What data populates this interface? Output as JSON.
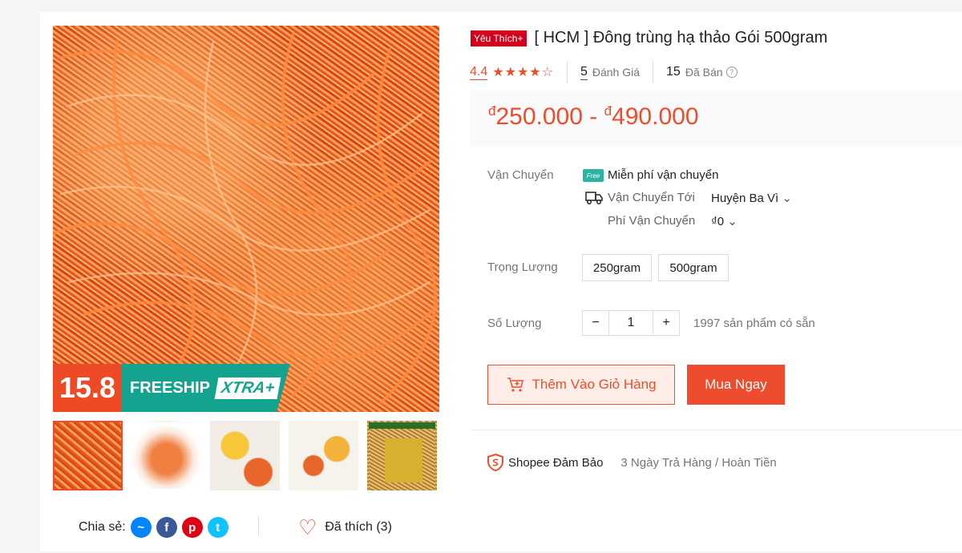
{
  "gallery": {
    "promo_number": "15.8",
    "promo_freeship": "FREESHIP",
    "promo_xtra": "XTRA+",
    "thumbnails": [
      "thumb-1",
      "thumb-2",
      "thumb-3",
      "thumb-4",
      "thumb-5"
    ]
  },
  "share": {
    "label": "Chia sẻ:"
  },
  "like": {
    "label": "Đã thích (3)"
  },
  "product": {
    "badge": "Yêu Thích+",
    "title": "[ HCM ] Đông trùng hạ thảo Gói 500gram",
    "rating": "4.4",
    "stars": "★★★★☆",
    "reviews_count": "5",
    "reviews_label": "Đánh Giá",
    "sold_count": "15",
    "sold_label": "Đã Bán",
    "price_currency": "đ",
    "price_min": "250.000",
    "price_sep": " - ",
    "price_max": "490.000"
  },
  "shipping": {
    "label": "Vận Chuyển",
    "free_badge": "Free",
    "free_text": "Miễn phí vận chuyển",
    "to_label": "Vận Chuyển Tới",
    "to_value": "Huyện Ba Vì",
    "fee_label": "Phí Vận Chuyển",
    "fee_value": "₫0"
  },
  "weight": {
    "label": "Trọng Lượng",
    "options": [
      "250gram",
      "500gram"
    ]
  },
  "quantity": {
    "label": "Số Lượng",
    "minus": "−",
    "value": "1",
    "plus": "+",
    "stock": "1997 sản phẩm có sẵn"
  },
  "actions": {
    "add_to_cart": "Thêm Vào Giỏ Hàng",
    "buy_now": "Mua Ngay"
  },
  "guarantee": {
    "title": "Shopee Đảm Bảo",
    "detail": "3 Ngày Trả Hàng / Hoàn Tiền"
  },
  "colors": {
    "accent": "#ee4d2d",
    "teal": "#13a38e"
  }
}
